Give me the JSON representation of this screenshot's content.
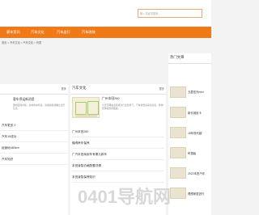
{
  "header": {
    "search_placeholder": "输入关键词搜索..."
  },
  "nav": {
    "items": [
      "豪车资讯",
      "汽车文化",
      "汽车出行",
      "汽车改装"
    ]
  },
  "breadcrumb": "首页 > 汽车文化 > 汽车文化 > 列表",
  "left_panel": {
    "more": "更多",
    "article": {
      "title": "客车停运新消息",
      "text": "国内疫情持续，多地客车停运，请乘客提前确认出行信息。"
    },
    "rows": [
      "汽车更多少",
      "汽车10成功",
      "经营地480km",
      "汽车知识"
    ]
  },
  "mid_panel": {
    "title": "汽车文化",
    "more": "更多",
    "article": {
      "title": "广州本田260",
      "text": "七天无理由退货成为行业新风气，汽车消费迎来新变化，各地经销商纷纷跟进。"
    },
    "rows": [
      "广州本田260",
      "懂得养车保养",
      "广汽本田商用车有哪几款车",
      "本田凌智价格配置详情",
      "本田凌智保养知识"
    ]
  },
  "right_panel": {
    "title": "热门文章",
    "items": [
      "五菱宏光mini",
      "新长城皮卡",
      "18年现代越",
      "轩逸胎",
      "2022本田汽车",
      "理想家居进行"
    ]
  },
  "watermark": "0401导航网"
}
